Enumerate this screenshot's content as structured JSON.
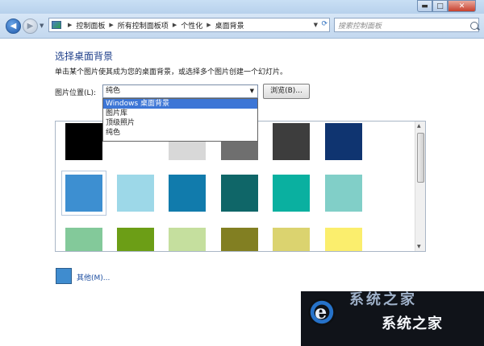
{
  "window": {
    "minimize_glyph": "▬",
    "maximize_glyph": "□",
    "close_glyph": "✕"
  },
  "nav": {
    "back_glyph": "◀",
    "forward_glyph": "▶",
    "history_glyph": "▼"
  },
  "breadcrumbs": [
    "控制面板",
    "所有控制面板项",
    "个性化",
    "桌面背景"
  ],
  "search": {
    "placeholder": "搜索控制面板"
  },
  "page": {
    "title": "选择桌面背景",
    "instruction": "单击某个图片使其成为您的桌面背景，或选择多个图片创建一个幻灯片。",
    "location_label": "图片位置(L):",
    "location_selected": "纯色",
    "browse_label": "浏览(B)...",
    "other_label": "其他(M)..."
  },
  "location_options": [
    {
      "label": "Windows 桌面背景",
      "highlighted": true
    },
    {
      "label": "图片库",
      "highlighted": false
    },
    {
      "label": "顶级照片",
      "highlighted": false
    },
    {
      "label": "纯色",
      "highlighted": false
    }
  ],
  "swatches": [
    [
      "#000000",
      "#ffffff",
      "#d8d8d8",
      "#6f6f6f",
      "#3d3d3d",
      "#0f3470"
    ],
    [
      "#3d8fd1",
      "#9dd8e8",
      "#117bac",
      "#0f6668",
      "#0ab0a0",
      "#81cfc8"
    ],
    [
      "#83c99a",
      "#6c9e16",
      "#c5df9e",
      "#827f22",
      "#dbd36f",
      "#fbee6d"
    ]
  ],
  "other_color": "#3f8ccf",
  "watermark": {
    "text": "系统之家",
    "faded_text": "系统之家"
  }
}
